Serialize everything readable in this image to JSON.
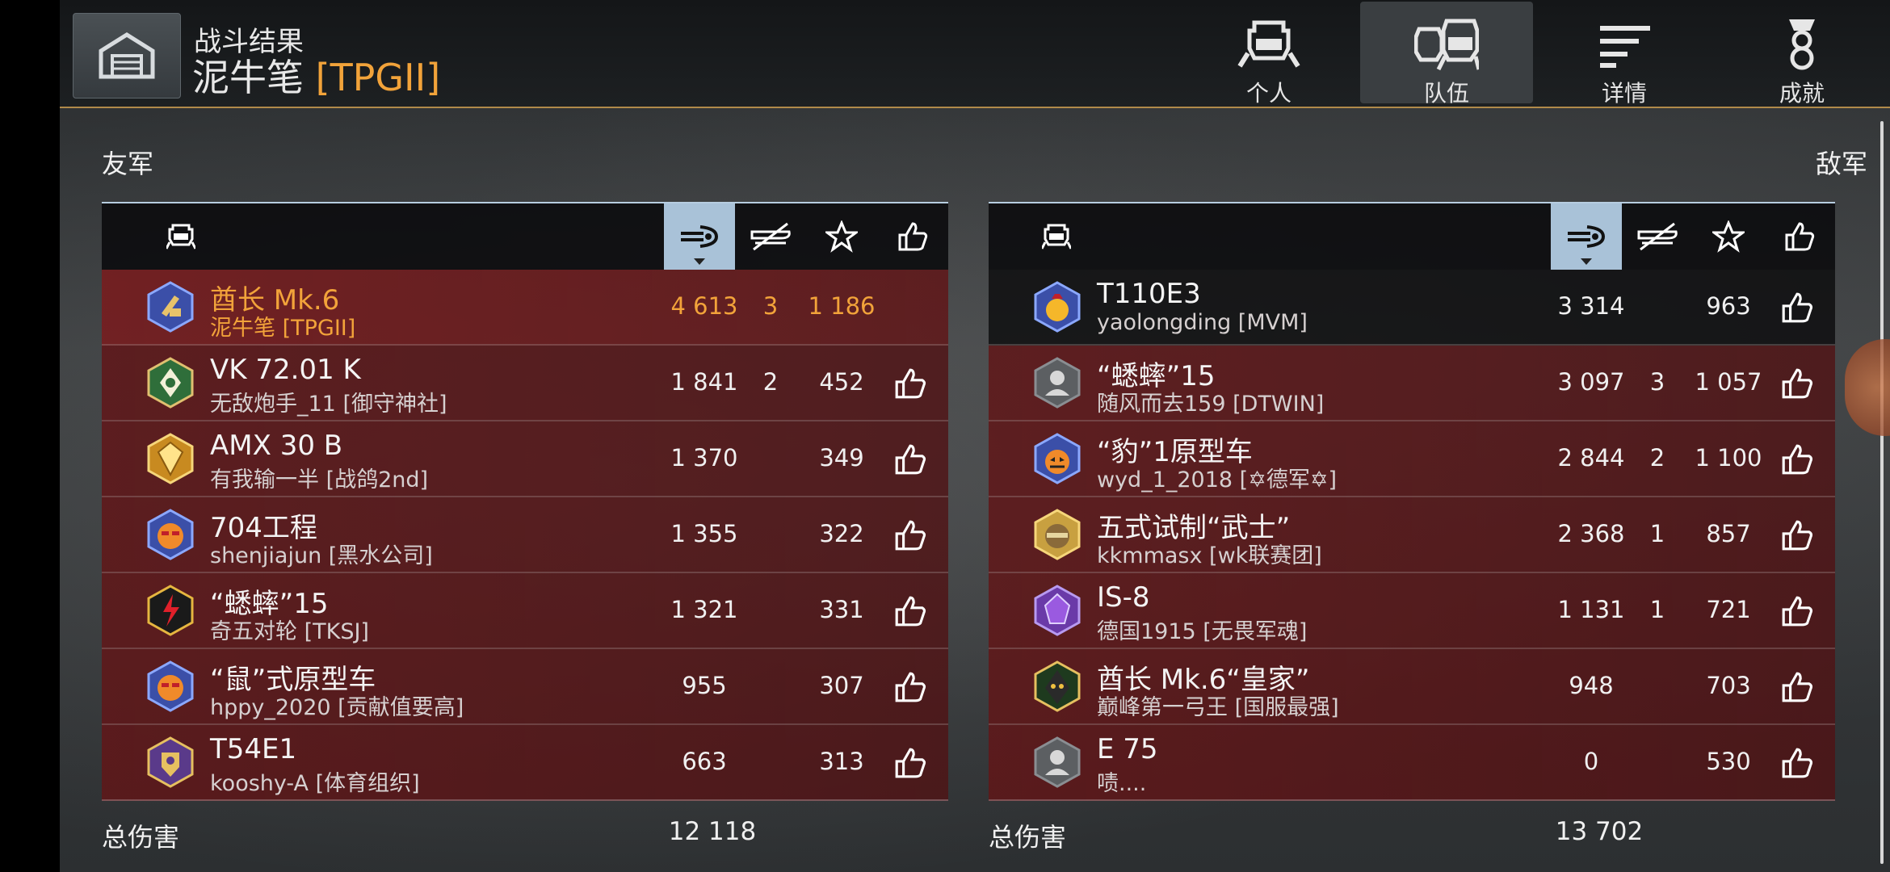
{
  "header": {
    "subtitle": "战斗结果",
    "player_name": "泥牛笔",
    "player_clan": "[TPGII]"
  },
  "tabs": [
    {
      "label": "个人",
      "icon": "personal-icon"
    },
    {
      "label": "队伍",
      "icon": "team-icon",
      "active": true
    },
    {
      "label": "详情",
      "icon": "details-icon"
    },
    {
      "label": "成就",
      "icon": "achievements-icon"
    }
  ],
  "friendly": {
    "label": "友军",
    "total_label": "总伤害",
    "total_damage": "12 118",
    "rows": [
      {
        "tank": "酋长 Mk.6",
        "player": "泥牛笔 [TPGII]",
        "damage": "4 613",
        "kills": "3",
        "xp": "1 186",
        "self": true
      },
      {
        "tank": "VK 72.01 K",
        "player": "无敌炮手_11 [御守神社]",
        "damage": "1 841",
        "kills": "2",
        "xp": "452"
      },
      {
        "tank": "AMX 30 B",
        "player": "有我输一半 [战鸽2nd]",
        "damage": "1 370",
        "kills": "",
        "xp": "349"
      },
      {
        "tank": "704工程",
        "player": "shenjiajun [黑水公司]",
        "damage": "1 355",
        "kills": "",
        "xp": "322"
      },
      {
        "tank": "“蟋蟀”15",
        "player": "奇五对轮 [TKSJ]",
        "damage": "1 321",
        "kills": "",
        "xp": "331"
      },
      {
        "tank": "“鼠”式原型车",
        "player": "hppy_2020 [贡献值要高]",
        "damage": "955",
        "kills": "",
        "xp": "307"
      },
      {
        "tank": "T54E1",
        "player": "kooshy-A [体育组织]",
        "damage": "663",
        "kills": "",
        "xp": "313"
      }
    ]
  },
  "enemy": {
    "label": "敌军",
    "total_label": "总伤害",
    "total_damage": "13 702",
    "rows": [
      {
        "tank": "T110E3",
        "player": "yaolongding [MVM]",
        "damage": "3 314",
        "kills": "",
        "xp": "963"
      },
      {
        "tank": "“蟋蟀”15",
        "player": "随风而去159 [DTWIN]",
        "damage": "3 097",
        "kills": "3",
        "xp": "1 057"
      },
      {
        "tank": "“豹”1原型车",
        "player": "wyd_1_2018 [✡德军✡]",
        "damage": "2 844",
        "kills": "2",
        "xp": "1 100"
      },
      {
        "tank": "五式试制“武士”",
        "player": "kkmmasx [wk联赛团]",
        "damage": "2 368",
        "kills": "1",
        "xp": "857"
      },
      {
        "tank": "IS-8",
        "player": "德国1915 [无畏军魂]",
        "damage": "1 131",
        "kills": "1",
        "xp": "721"
      },
      {
        "tank": "酋长 Mk.6“皇家”",
        "player": "巅峰第一弓王 [国服最强]",
        "damage": "948",
        "kills": "",
        "xp": "703"
      },
      {
        "tank": "E 75",
        "player": "啧....",
        "damage": "0",
        "kills": "",
        "xp": "530"
      }
    ]
  },
  "colors": {
    "accent_orange": "#f2a33a",
    "row_red": "#601618",
    "sorted_header_blue": "#a9c2d8"
  }
}
